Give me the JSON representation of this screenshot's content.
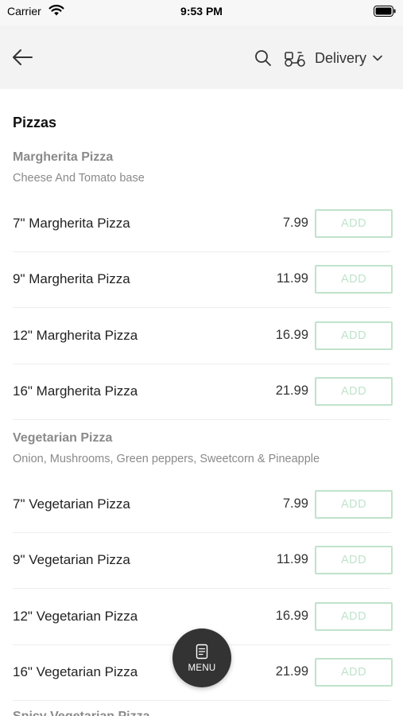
{
  "status_bar": {
    "carrier": "Carrier",
    "time": "9:53 PM"
  },
  "nav": {
    "back_icon": "arrow-left-icon",
    "search_icon": "search-icon",
    "delivery_icon": "scooter-icon",
    "delivery_label": "Delivery",
    "dropdown_icon": "chevron-down-icon"
  },
  "section": {
    "title": "Pizzas"
  },
  "groups": [
    {
      "name": "Margherita Pizza",
      "description": "Cheese And Tomato base",
      "items": [
        {
          "name": "7\" Margherita Pizza",
          "price": "7.99",
          "action": "ADD"
        },
        {
          "name": "9\" Margherita Pizza",
          "price": "11.99",
          "action": "ADD"
        },
        {
          "name": "12\" Margherita Pizza",
          "price": "16.99",
          "action": "ADD"
        },
        {
          "name": "16\" Margherita Pizza",
          "price": "21.99",
          "action": "ADD"
        }
      ]
    },
    {
      "name": "Vegetarian Pizza",
      "description": "Onion, Mushrooms, Green peppers, Sweetcorn & Pineapple",
      "items": [
        {
          "name": "7\" Vegetarian Pizza",
          "price": "7.99",
          "action": "ADD"
        },
        {
          "name": "9\" Vegetarian Pizza",
          "price": "11.99",
          "action": "ADD"
        },
        {
          "name": "12\" Vegetarian Pizza",
          "price": "16.99",
          "action": "ADD"
        },
        {
          "name": "16\" Vegetarian Pizza",
          "price": "21.99",
          "action": "ADD"
        }
      ]
    }
  ],
  "next_group_peek": "Spicy Vegetarian Pizza",
  "fab": {
    "label": "MENU",
    "icon": "menu-book-icon"
  },
  "colors": {
    "nav_background": "#f3f3f3",
    "add_button_accent": "#bfe3cb",
    "fab_background": "#333333"
  }
}
